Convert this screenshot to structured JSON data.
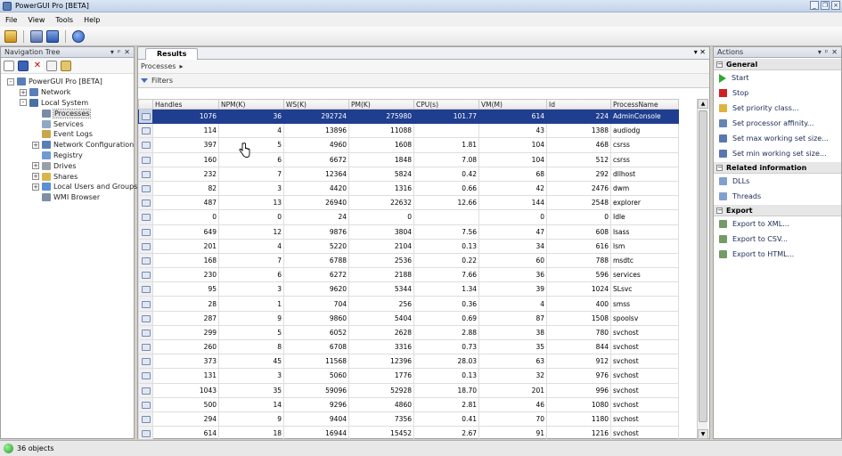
{
  "window": {
    "title": "PowerGUI Pro [BETA]",
    "controls": [
      "_",
      "❐",
      "×"
    ]
  },
  "menu": [
    {
      "label": "File"
    },
    {
      "label": "View"
    },
    {
      "label": "Tools"
    },
    {
      "label": "Help"
    }
  ],
  "nav": {
    "header": "Navigation Tree",
    "tree": [
      {
        "label": "PowerGUI Pro [BETA]",
        "level": 0,
        "expander": "-",
        "icon": "powergui-icon"
      },
      {
        "label": "Network",
        "level": 1,
        "expander": "+",
        "icon": "network-icon"
      },
      {
        "label": "Local System",
        "level": 1,
        "expander": "-",
        "icon": "computer-icon"
      },
      {
        "label": "Processes",
        "level": 2,
        "expander": "",
        "icon": "processes-icon",
        "selected": true
      },
      {
        "label": "Services",
        "level": 2,
        "expander": "",
        "icon": "services-icon"
      },
      {
        "label": "Event Logs",
        "level": 2,
        "expander": "",
        "icon": "eventlog-icon"
      },
      {
        "label": "Network Configuration",
        "level": 2,
        "expander": "+",
        "icon": "network-config-icon"
      },
      {
        "label": "Registry",
        "level": 2,
        "expander": "",
        "icon": "registry-icon"
      },
      {
        "label": "Drives",
        "level": 2,
        "expander": "+",
        "icon": "drives-icon"
      },
      {
        "label": "Shares",
        "level": 2,
        "expander": "+",
        "icon": "shares-icon"
      },
      {
        "label": "Local Users and Groups",
        "level": 2,
        "expander": "+",
        "icon": "users-icon"
      },
      {
        "label": "WMI Browser",
        "level": 2,
        "expander": "",
        "icon": "wmi-icon"
      }
    ]
  },
  "results": {
    "tab": "Results",
    "breadcrumb": "Processes",
    "filters": "Filters",
    "columns": [
      "Handles",
      "NPM(K)",
      "WS(K)",
      "PM(K)",
      "CPU(s)",
      "VM(M)",
      "Id",
      "ProcessName"
    ],
    "rows": [
      [
        "1076",
        "36",
        "292724",
        "275980",
        "101.77",
        "614",
        "224",
        "AdminConsole"
      ],
      [
        "114",
        "4",
        "13896",
        "11088",
        "",
        "43",
        "1388",
        "audiodg"
      ],
      [
        "397",
        "5",
        "4960",
        "1608",
        "1.81",
        "104",
        "468",
        "csrss"
      ],
      [
        "160",
        "6",
        "6672",
        "1848",
        "7.08",
        "104",
        "512",
        "csrss"
      ],
      [
        "232",
        "7",
        "12364",
        "5824",
        "0.42",
        "68",
        "292",
        "dllhost"
      ],
      [
        "82",
        "3",
        "4420",
        "1316",
        "0.66",
        "42",
        "2476",
        "dwm"
      ],
      [
        "487",
        "13",
        "26940",
        "22632",
        "12.66",
        "144",
        "2548",
        "explorer"
      ],
      [
        "0",
        "0",
        "24",
        "0",
        "",
        "0",
        "0",
        "Idle"
      ],
      [
        "649",
        "12",
        "9876",
        "3804",
        "7.56",
        "47",
        "608",
        "lsass"
      ],
      [
        "201",
        "4",
        "5220",
        "2104",
        "0.13",
        "34",
        "616",
        "lsm"
      ],
      [
        "168",
        "7",
        "6788",
        "2536",
        "0.22",
        "60",
        "788",
        "msdtc"
      ],
      [
        "230",
        "6",
        "6272",
        "2188",
        "7.66",
        "36",
        "596",
        "services"
      ],
      [
        "95",
        "3",
        "9620",
        "5344",
        "1.34",
        "39",
        "1024",
        "SLsvc"
      ],
      [
        "28",
        "1",
        "704",
        "256",
        "0.36",
        "4",
        "400",
        "smss"
      ],
      [
        "287",
        "9",
        "9860",
        "5404",
        "0.69",
        "87",
        "1508",
        "spoolsv"
      ],
      [
        "299",
        "5",
        "6052",
        "2628",
        "2.88",
        "38",
        "780",
        "svchost"
      ],
      [
        "260",
        "8",
        "6708",
        "3316",
        "0.73",
        "35",
        "844",
        "svchost"
      ],
      [
        "373",
        "45",
        "11568",
        "12396",
        "28.03",
        "63",
        "912",
        "svchost"
      ],
      [
        "131",
        "3",
        "5060",
        "1776",
        "0.13",
        "32",
        "976",
        "svchost"
      ],
      [
        "1043",
        "35",
        "59096",
        "52928",
        "18.70",
        "201",
        "996",
        "svchost"
      ],
      [
        "500",
        "14",
        "9296",
        "4860",
        "2.81",
        "46",
        "1080",
        "svchost"
      ],
      [
        "294",
        "9",
        "9404",
        "7356",
        "0.41",
        "70",
        "1180",
        "svchost"
      ],
      [
        "614",
        "18",
        "16944",
        "15452",
        "2.67",
        "91",
        "1216",
        "svchost"
      ]
    ]
  },
  "actions": {
    "header": "Actions",
    "sections": [
      {
        "title": "General",
        "items": [
          {
            "label": "Start",
            "icon": "start-icon",
            "color": "#2eaa2e"
          },
          {
            "label": "Stop",
            "icon": "stop-icon",
            "color": "#cc2222"
          },
          {
            "label": "Set priority class...",
            "icon": "priority-icon",
            "color": "#d9a520"
          },
          {
            "label": "Set processor affinity...",
            "icon": "affinity-icon",
            "color": "#4a6fa5"
          },
          {
            "label": "Set max working set size...",
            "icon": "max-working-set-icon",
            "color": "#3b5fa0"
          },
          {
            "label": "Set min working set size...",
            "icon": "min-working-set-icon",
            "color": "#3b5fa0"
          }
        ]
      },
      {
        "title": "Related information",
        "items": [
          {
            "label": "DLLs",
            "icon": "dlls-icon",
            "color": "#6b8fc7"
          },
          {
            "label": "Threads",
            "icon": "threads-icon",
            "color": "#6b8fc7"
          }
        ]
      },
      {
        "title": "Export",
        "items": [
          {
            "label": "Export to XML...",
            "icon": "export-xml-icon",
            "color": "#5a8a4a"
          },
          {
            "label": "Export to CSV...",
            "icon": "export-csv-icon",
            "color": "#5a8a4a"
          },
          {
            "label": "Export to HTML...",
            "icon": "export-html-icon",
            "color": "#5a8a4a"
          }
        ]
      }
    ]
  },
  "status": {
    "text": "36 objects"
  }
}
